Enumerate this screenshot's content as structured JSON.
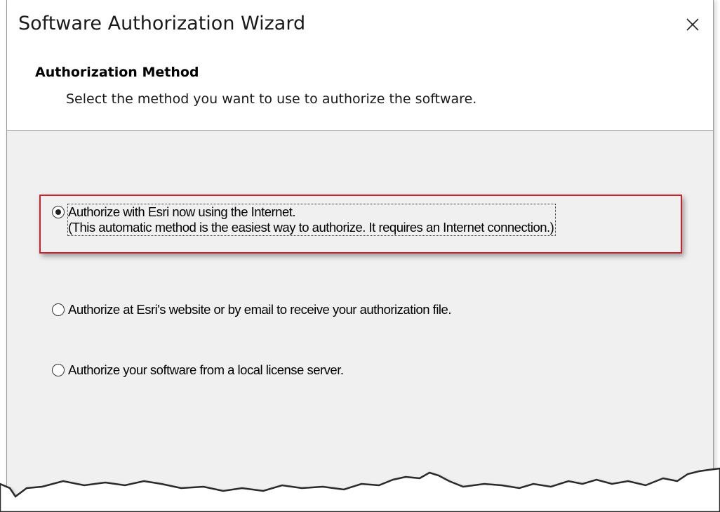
{
  "window": {
    "title": "Software Authorization Wizard",
    "close_symbol": "×"
  },
  "header": {
    "title": "Authorization Method",
    "subtitle": "Select the method you want to use to authorize the software."
  },
  "options": [
    {
      "line1": "Authorize with Esri now using the Internet.",
      "line2": "(This automatic method is the easiest way to authorize. It requires an Internet connection.)",
      "checked": true
    },
    {
      "line1": "Authorize at Esri's website or by email to receive your authorization file.",
      "checked": false
    },
    {
      "line1": "Authorize your software from a local license server.",
      "checked": false
    }
  ],
  "colors": {
    "highlight": "#c8232c",
    "panel_bg": "#f0f0f0",
    "header_bg": "#ffffff"
  }
}
